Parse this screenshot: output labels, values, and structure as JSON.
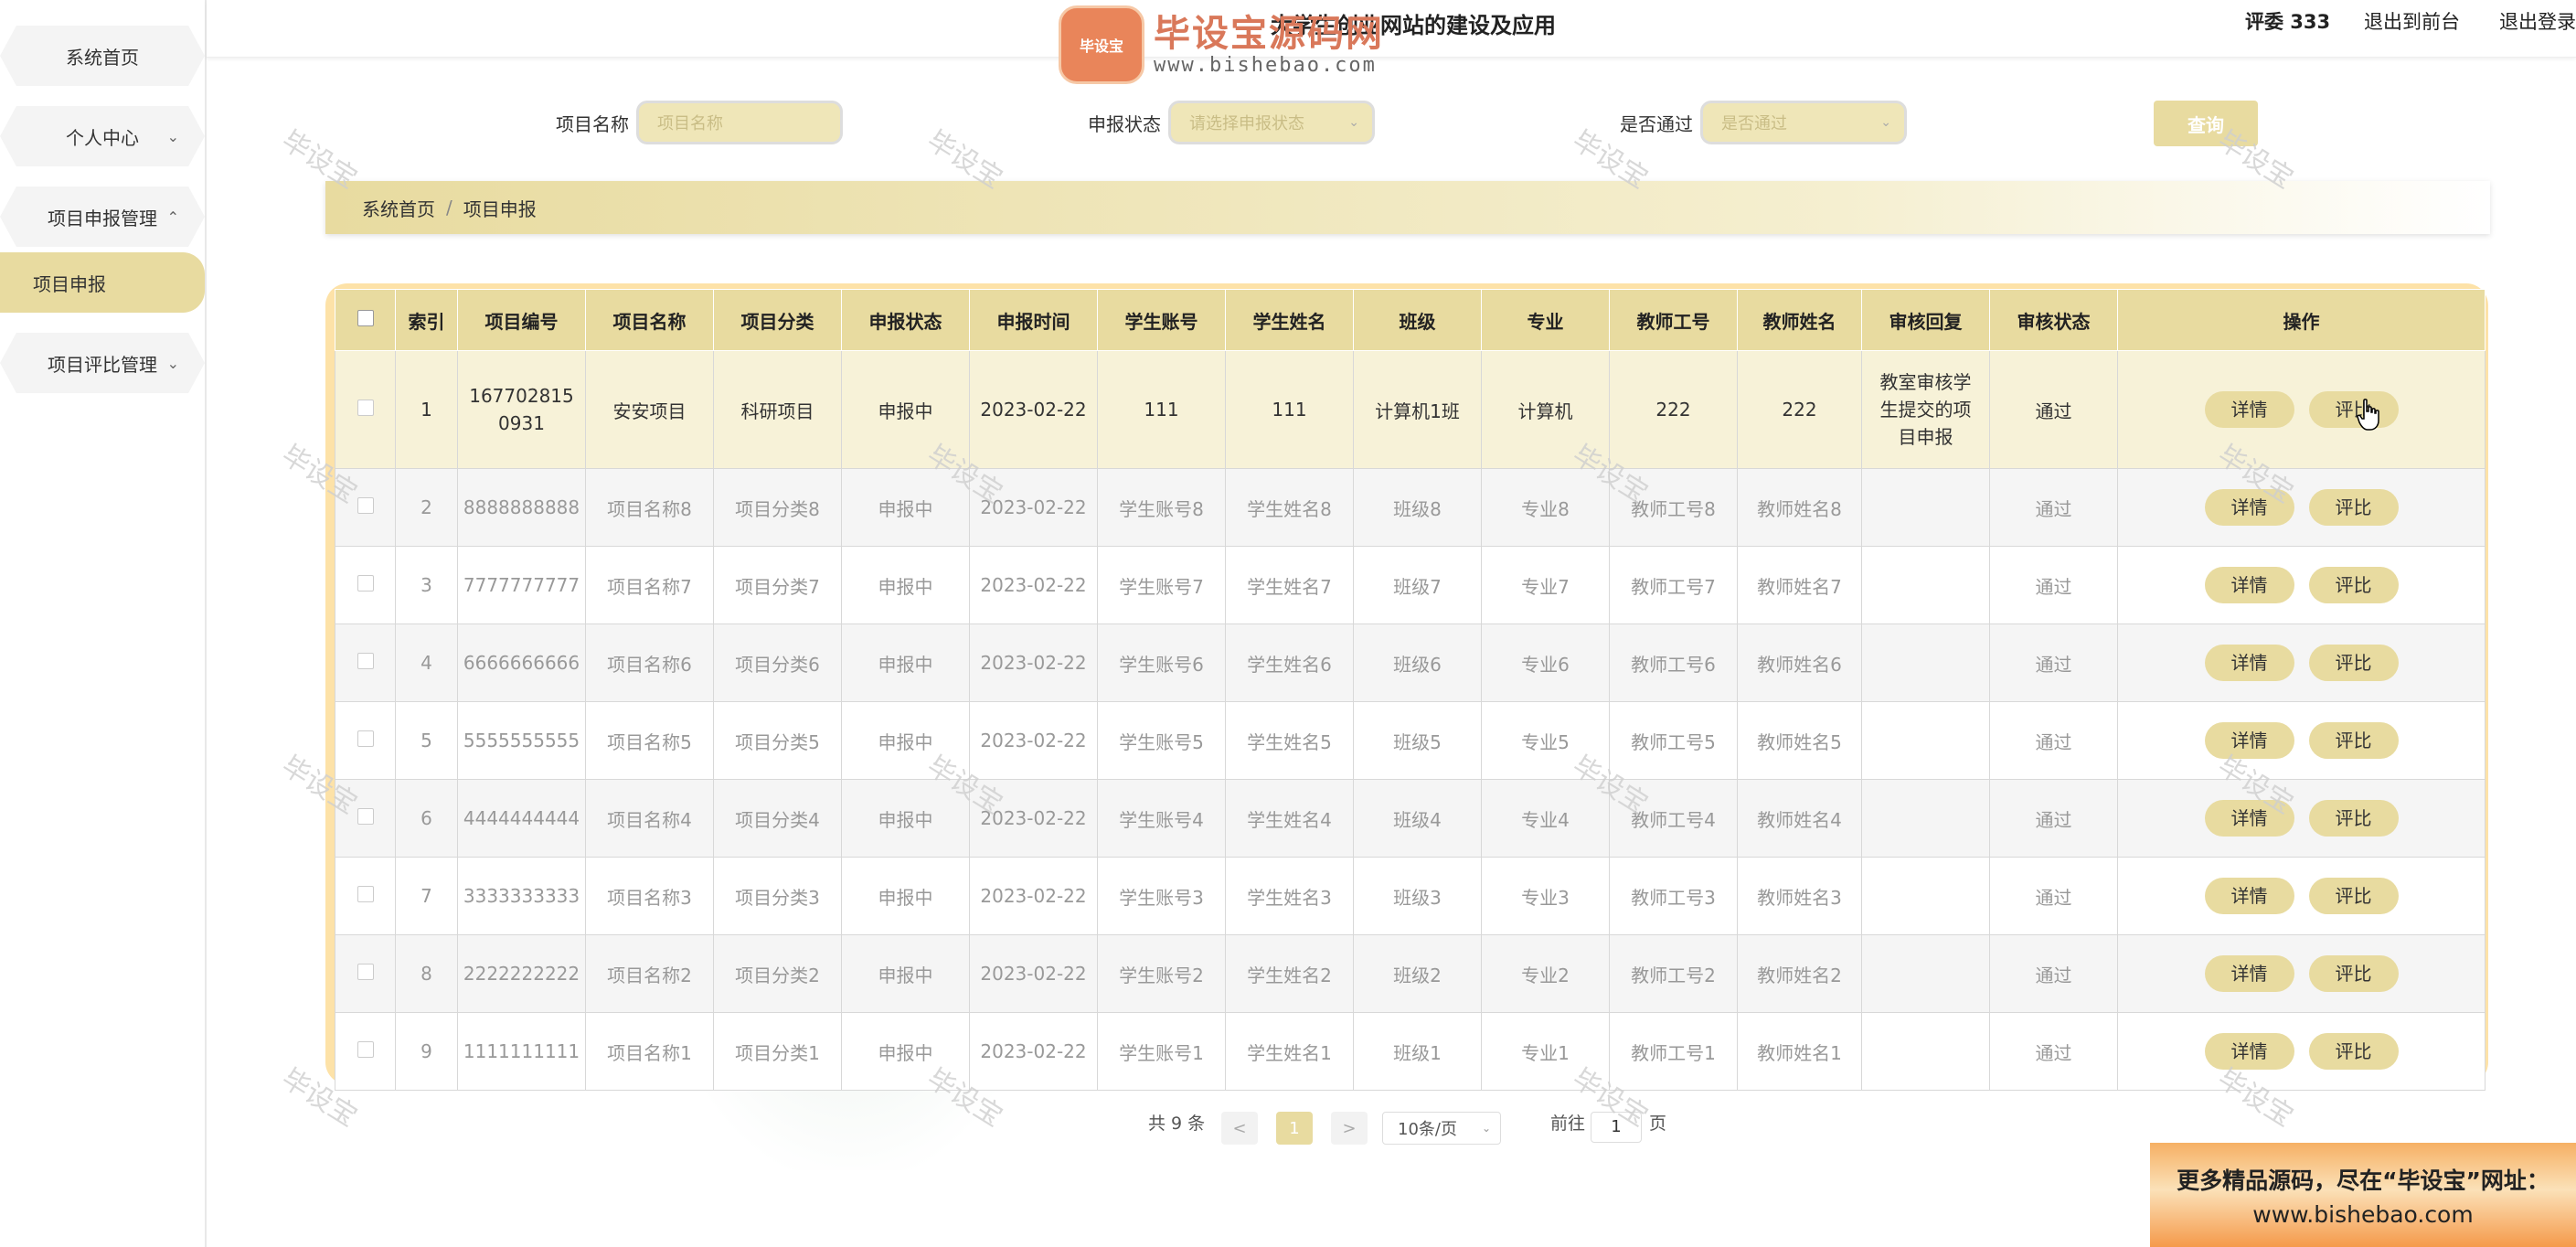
{
  "header": {
    "site_title": "大学生创业网站的建设及应用",
    "user": "评委 333",
    "link_front": "退出到前台",
    "link_logout": "退出登录",
    "logo_badge": "毕设宝",
    "logo_text": "毕设宝源码网",
    "logo_url": "www.bishebao.com"
  },
  "sidebar": {
    "items": [
      {
        "label": "系统首页"
      },
      {
        "label": "个人中心"
      },
      {
        "label": "项目申报管理"
      },
      {
        "label": "项目申报"
      },
      {
        "label": "项目评比管理"
      }
    ]
  },
  "search": {
    "name_label": "项目名称",
    "name_placeholder": "项目名称",
    "status_label": "申报状态",
    "status_placeholder": "请选择申报状态",
    "pass_label": "是否通过",
    "pass_placeholder": "是否通过",
    "query_button": "查询"
  },
  "breadcrumb": {
    "home": "系统首页",
    "sep": "/",
    "current": "项目申报"
  },
  "table": {
    "columns": [
      "索引",
      "项目编号",
      "项目名称",
      "项目分类",
      "申报状态",
      "申报时间",
      "学生账号",
      "学生姓名",
      "班级",
      "专业",
      "教师工号",
      "教师姓名",
      "审核回复",
      "审核状态",
      "操作"
    ],
    "detail_label": "详情",
    "rate_label": "评比",
    "rows": [
      [
        "1",
        "1677028150931",
        "安安项目",
        "科研项目",
        "申报中",
        "2023-02-22",
        "111",
        "111",
        "计算机1班",
        "计算机",
        "222",
        "222",
        "教室审核学生提交的项目申报",
        "通过"
      ],
      [
        "2",
        "8888888888",
        "项目名称8",
        "项目分类8",
        "申报中",
        "2023-02-22",
        "学生账号8",
        "学生姓名8",
        "班级8",
        "专业8",
        "教师工号8",
        "教师姓名8",
        "",
        "通过"
      ],
      [
        "3",
        "7777777777",
        "项目名称7",
        "项目分类7",
        "申报中",
        "2023-02-22",
        "学生账号7",
        "学生姓名7",
        "班级7",
        "专业7",
        "教师工号7",
        "教师姓名7",
        "",
        "通过"
      ],
      [
        "4",
        "6666666666",
        "项目名称6",
        "项目分类6",
        "申报中",
        "2023-02-22",
        "学生账号6",
        "学生姓名6",
        "班级6",
        "专业6",
        "教师工号6",
        "教师姓名6",
        "",
        "通过"
      ],
      [
        "5",
        "5555555555",
        "项目名称5",
        "项目分类5",
        "申报中",
        "2023-02-22",
        "学生账号5",
        "学生姓名5",
        "班级5",
        "专业5",
        "教师工号5",
        "教师姓名5",
        "",
        "通过"
      ],
      [
        "6",
        "4444444444",
        "项目名称4",
        "项目分类4",
        "申报中",
        "2023-02-22",
        "学生账号4",
        "学生姓名4",
        "班级4",
        "专业4",
        "教师工号4",
        "教师姓名4",
        "",
        "通过"
      ],
      [
        "7",
        "3333333333",
        "项目名称3",
        "项目分类3",
        "申报中",
        "2023-02-22",
        "学生账号3",
        "学生姓名3",
        "班级3",
        "专业3",
        "教师工号3",
        "教师姓名3",
        "",
        "通过"
      ],
      [
        "8",
        "2222222222",
        "项目名称2",
        "项目分类2",
        "申报中",
        "2023-02-22",
        "学生账号2",
        "学生姓名2",
        "班级2",
        "专业2",
        "教师工号2",
        "教师姓名2",
        "",
        "通过"
      ],
      [
        "9",
        "1111111111",
        "项目名称1",
        "项目分类1",
        "申报中",
        "2023-02-22",
        "学生账号1",
        "学生姓名1",
        "班级1",
        "专业1",
        "教师工号1",
        "教师姓名1",
        "",
        "通过"
      ]
    ]
  },
  "pagination": {
    "total": "共 9 条",
    "prev": "<",
    "page": "1",
    "next": ">",
    "page_size": "10条/页",
    "goto_label": "前往",
    "goto_value": "1",
    "goto_suffix": "页"
  },
  "watermark": "毕设宝",
  "ad": {
    "line1": "更多精品源码，尽在“毕设宝”网址：",
    "line2": "www.bishebao.com"
  },
  "colors": {
    "accent": "#e8dba0",
    "table_frame": "#fde2a8"
  }
}
